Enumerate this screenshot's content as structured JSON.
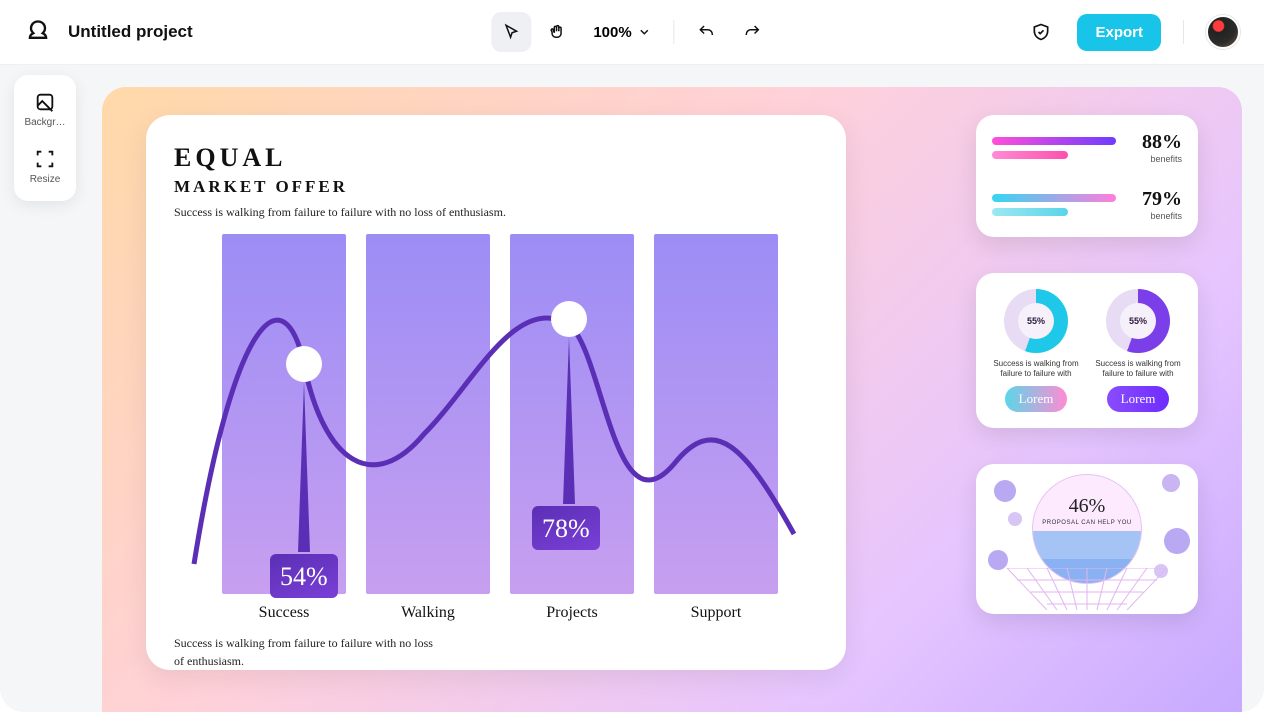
{
  "header": {
    "project_title": "Untitled project",
    "zoom": "100%",
    "export_label": "Export"
  },
  "sidebar": {
    "items": [
      {
        "label": "Backgr…"
      },
      {
        "label": "Resize"
      }
    ]
  },
  "main": {
    "title": "EQUAL",
    "subtitle": "MARKET OFFER",
    "tagline": "Success is walking from failure to failure with no loss of enthusiasm.",
    "footnote": "Success is walking from failure to failure with no loss of enthusiasm.",
    "callout1": "54%",
    "callout2": "78%",
    "categories": [
      "Success",
      "Walking",
      "Projects",
      "Support"
    ]
  },
  "right": {
    "progress": [
      {
        "pct": "88%",
        "label": "benefits"
      },
      {
        "pct": "79%",
        "label": "benefits"
      }
    ],
    "donuts": [
      {
        "value": "55%",
        "text": "Success is walking from failure to failure with",
        "btn": "Lorem"
      },
      {
        "value": "55%",
        "text": "Success is walking from failure to failure with",
        "btn": "Lorem"
      }
    ],
    "bubble": {
      "pct": "46%",
      "text": "PROPOSAL CAN HELP YOU"
    }
  },
  "chart_data": {
    "type": "bar",
    "title": "EQUAL MARKET OFFER",
    "categories": [
      "Success",
      "Walking",
      "Projects",
      "Support"
    ],
    "series": [
      {
        "name": "line-callouts",
        "values": [
          54,
          null,
          78,
          null
        ]
      }
    ],
    "side_metrics": {
      "benefits": [
        88,
        79
      ],
      "donuts": [
        55,
        55
      ],
      "bubble": 46
    }
  }
}
